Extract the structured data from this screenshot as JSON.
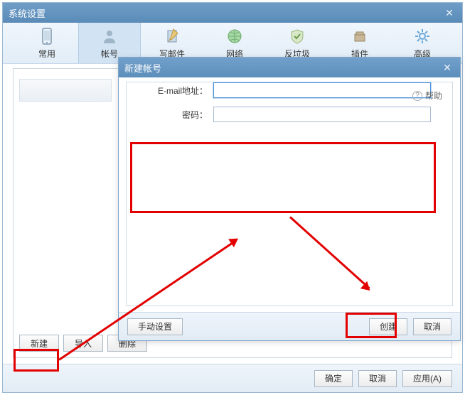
{
  "main": {
    "title": "系统设置",
    "tabs": [
      {
        "label": "常用",
        "icon": "phone-icon"
      },
      {
        "label": "帐号",
        "icon": "user-icon"
      },
      {
        "label": "写邮件",
        "icon": "compose-icon"
      },
      {
        "label": "网络",
        "icon": "globe-icon"
      },
      {
        "label": "反垃圾",
        "icon": "shield-icon"
      },
      {
        "label": "插件",
        "icon": "plugin-icon"
      },
      {
        "label": "高级",
        "icon": "gear-icon"
      }
    ],
    "buttons": {
      "new": "新建",
      "import": "导入",
      "delete": "删除",
      "ok": "确定",
      "cancel": "取消",
      "apply": "应用(A)"
    }
  },
  "dialog": {
    "title": "新建帐号",
    "help": "帮助",
    "email_label": "E-mail地址：",
    "password_label": "密码：",
    "email_value": "",
    "password_value": "",
    "buttons": {
      "manual": "手动设置",
      "create": "创建",
      "cancel": "取消"
    }
  }
}
